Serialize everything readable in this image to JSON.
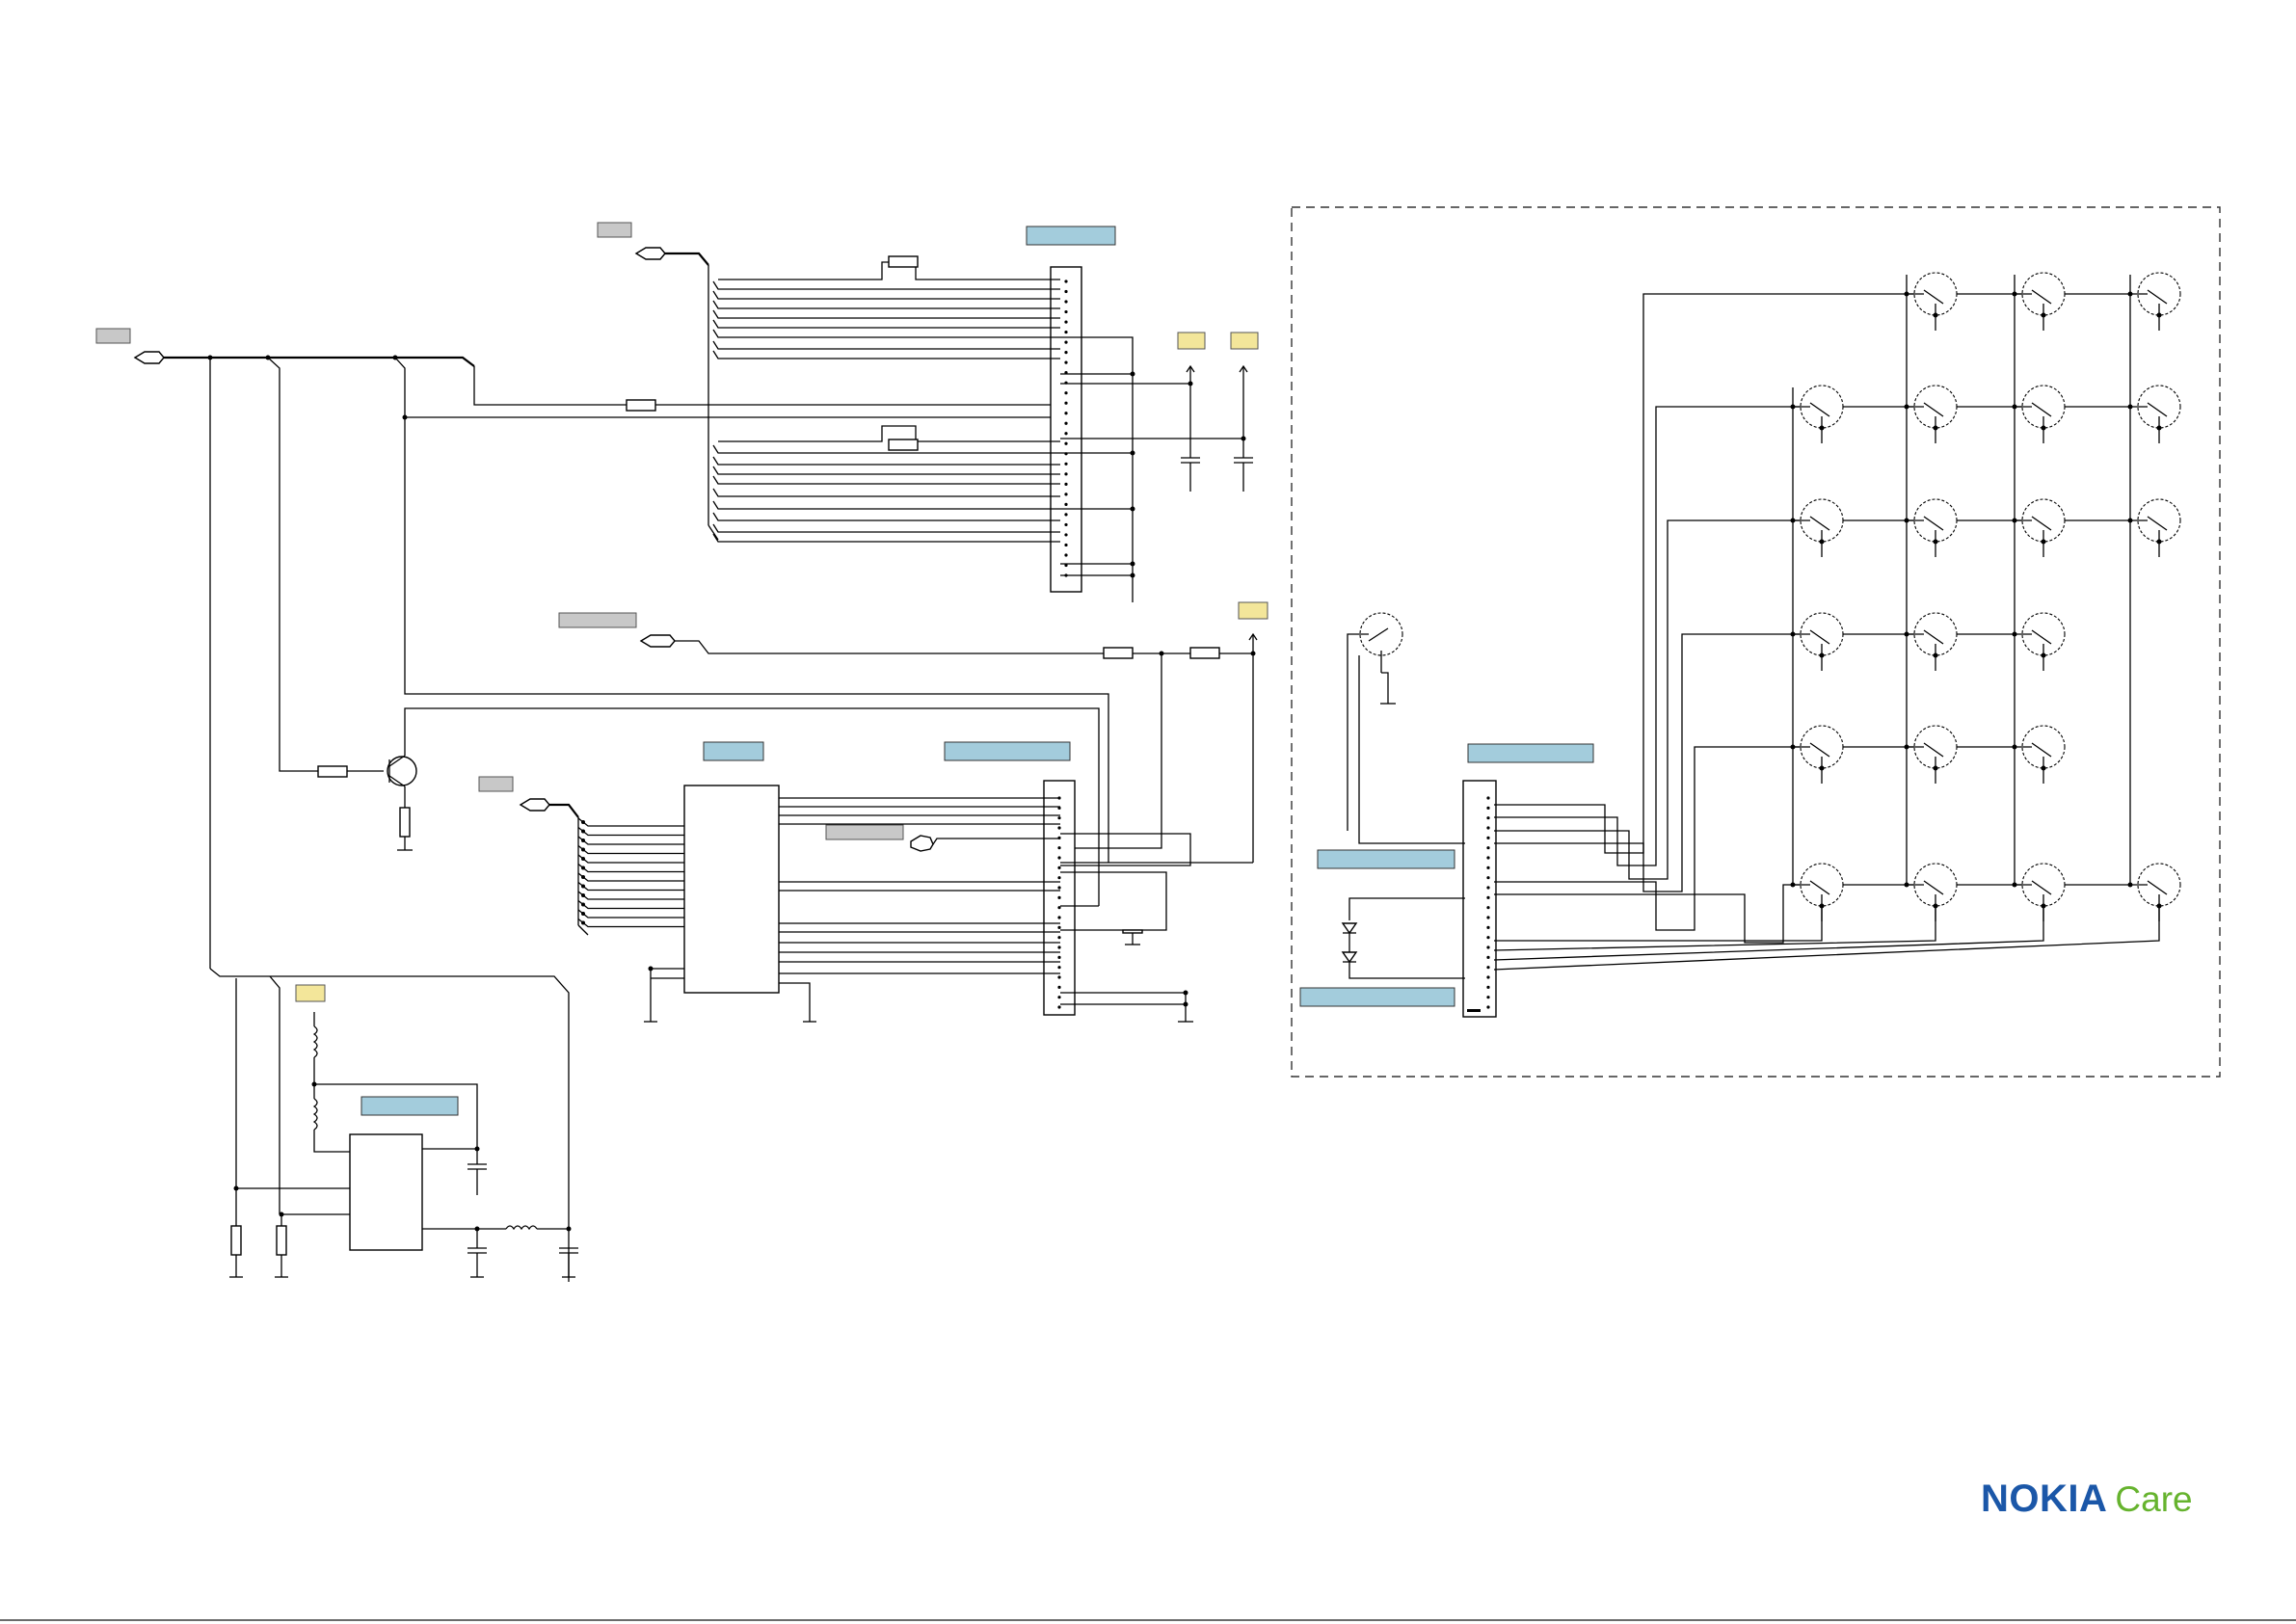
{
  "logo": {
    "brand": "NOKIA",
    "product": "Care"
  },
  "colors": {
    "blue_label": "#a3ccdc",
    "grey_label": "#c8c8c8",
    "yellow_label": "#f3e69a",
    "brand_blue": "#1b57a8",
    "brand_green": "#66b32e"
  },
  "keypad": {
    "key_rows": 6,
    "key_columns": 4
  }
}
